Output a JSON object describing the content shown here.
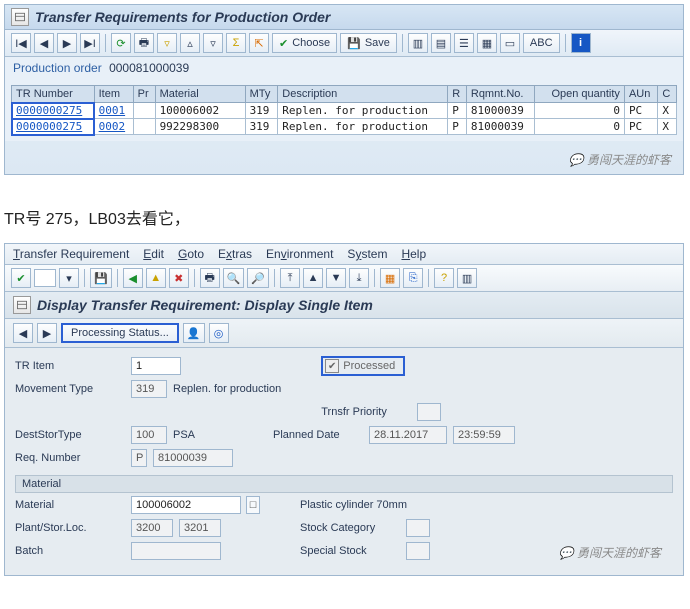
{
  "win1": {
    "title": "Transfer Requirements for Production Order",
    "toolbar": {
      "choose": "Choose",
      "save": "Save",
      "abc": "ABC"
    },
    "info": {
      "label": "Production order",
      "value": "000081000039"
    },
    "columns": [
      "TR Number",
      "Item",
      "Pr",
      "Material",
      "MTy",
      "Description",
      "R",
      "Rqmnt.No.",
      "Open quantity",
      "AUn",
      "C"
    ],
    "rows": [
      {
        "tr": "0000000275",
        "item": "0001",
        "pr": "",
        "material": "100006002",
        "mty": "319",
        "desc": "Replen. for production",
        "r": "P",
        "rqmt": "81000039",
        "openqty": "0",
        "aun": "PC",
        "c": "X"
      },
      {
        "tr": "0000000275",
        "item": "0002",
        "pr": "",
        "material": "992298300",
        "mty": "319",
        "desc": "Replen. for production",
        "r": "P",
        "rqmt": "81000039",
        "openqty": "0",
        "aun": "PC",
        "c": "X"
      }
    ],
    "watermark": "勇闯天涯的虾客"
  },
  "mid_text": "TR号 275，LB03去看它，",
  "win2": {
    "menus": [
      "Transfer Requirement",
      "Edit",
      "Goto",
      "Extras",
      "Environment",
      "System",
      "Help"
    ],
    "title": "Display Transfer Requirement: Display Single Item",
    "subtool": {
      "proc_status": "Processing Status..."
    },
    "form": {
      "tr_item_label": "TR Item",
      "tr_item": "1",
      "processed_label": "Processed",
      "mvt_label": "Movement Type",
      "mvt": "319",
      "mvt_desc": "Replen. for production",
      "trnsfr_prio_label": "Trnsfr Priority",
      "trnsfr_prio": "",
      "dest_label": "DestStorType",
      "dest": "100",
      "dest_desc": "PSA",
      "planned_label": "Planned Date",
      "planned_date": "28.11.2017",
      "planned_time": "23:59:59",
      "req_label": "Req. Number",
      "req_r": "P",
      "req_no": "81000039",
      "section": "Material",
      "material_label": "Material",
      "material": "100006002",
      "material_desc": "Plastic cylinder 70mm",
      "plant_label": "Plant/Stor.Loc.",
      "plant": "3200",
      "sloc": "3201",
      "stockcat_label": "Stock Category",
      "stockcat": "",
      "batch_label": "Batch",
      "batch": "",
      "special_label": "Special Stock",
      "special": ""
    },
    "watermark": "勇闯天涯的虾客"
  }
}
